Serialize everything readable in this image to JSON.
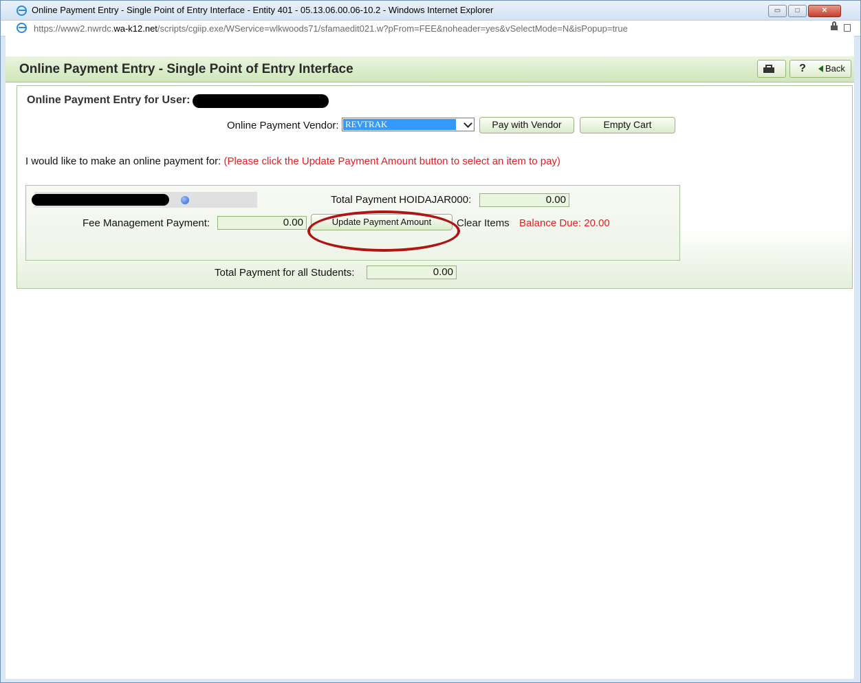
{
  "window": {
    "title": "Online Payment Entry - Single Point of Entry Interface - Entity 401 - 05.13.06.00.06-10.2 - Windows Internet Explorer",
    "url_prefix": "https://www2.nwrdc.",
    "url_host": "wa-k12.net",
    "url_path": "/scripts/cgiip.exe/WService=wlkwoods71/sfamaedit021.w?pFrom=FEE&noheader=yes&vSelectMode=N&isPopup=true",
    "minimize_glyph": "▭",
    "maximize_glyph": "□",
    "close_glyph": "✕"
  },
  "header": {
    "title": "Online Payment Entry - Single Point of Entry Interface",
    "help_label": "?",
    "back_label": "Back"
  },
  "panel": {
    "title": "Online Payment Entry for User:",
    "vendor_label": "Online Payment Vendor:",
    "vendor_value": "REVTRAK",
    "pay_with_vendor_label": "Pay with Vendor",
    "empty_cart_label": "Empty Cart",
    "intro_text": "I would like to make an online payment for:",
    "intro_instruction": "(Please click the Update Payment Amount button to select an item to pay)"
  },
  "student": {
    "total_payment_label": "Total Payment HOIDAJAR000:",
    "total_payment_value": "0.00",
    "fee_label": "Fee Management Payment:",
    "fee_value": "0.00",
    "update_button_label": "Update Payment Amount",
    "clear_items_label": "Clear Items",
    "balance_due": "Balance Due: 20.00"
  },
  "totals": {
    "all_students_label": "Total Payment for all Students:",
    "all_students_value": "0.00"
  },
  "colors": {
    "header_green": "#cfe6b9",
    "alert_red": "#e02020",
    "annotation_circle": "#b01515",
    "select_highlight": "#3399ff"
  }
}
